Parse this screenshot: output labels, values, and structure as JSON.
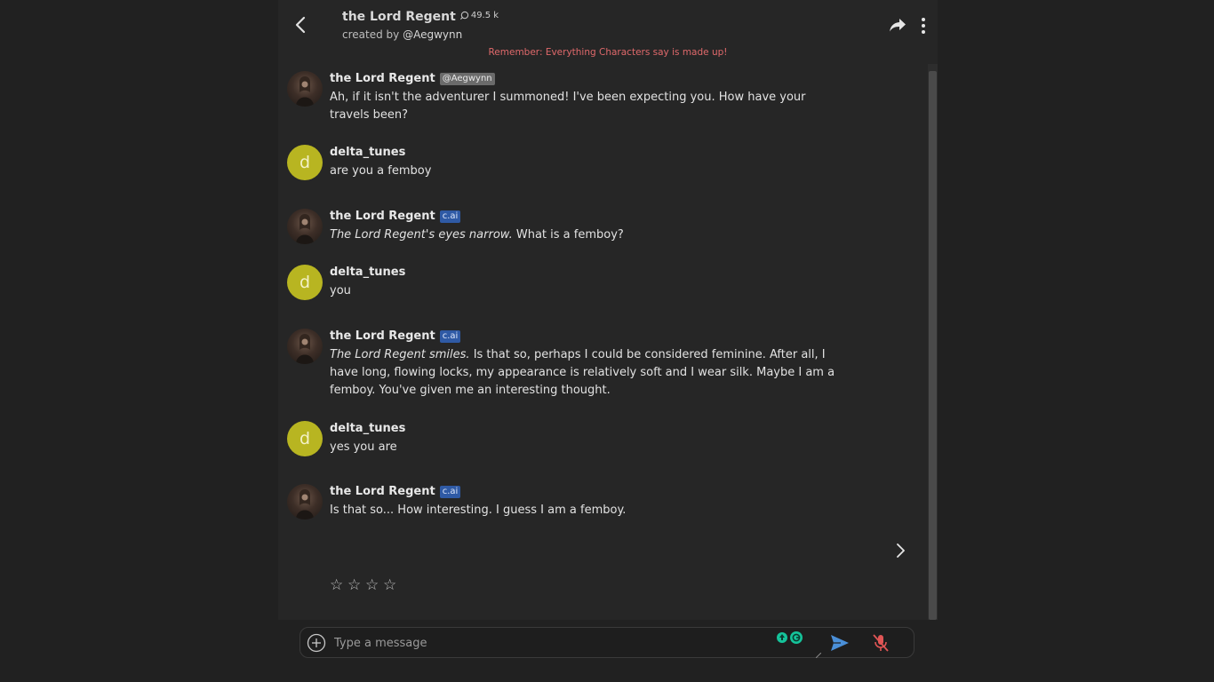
{
  "header": {
    "title": "the Lord Regent",
    "interactions": "49.5 k",
    "created_by_prefix": "created by",
    "created_by_handle": "@Aegwynn",
    "disclaimer": "Remember: Everything Characters say is made up!"
  },
  "messages": [
    {
      "author": "the Lord Regent",
      "badge": "@Aegwynn",
      "italic": "",
      "text": "Ah, if it isn't the adventurer I summoned! I've been expecting you. How have your travels been?"
    },
    {
      "author": "delta_tunes",
      "avatar_letter": "d",
      "text": "are you a femboy"
    },
    {
      "author": "the Lord Regent",
      "badge": "c.ai",
      "italic": "The Lord Regent's eyes narrow.",
      "text": " What is a femboy?"
    },
    {
      "author": "delta_tunes",
      "avatar_letter": "d",
      "text": "you"
    },
    {
      "author": "the Lord Regent",
      "badge": "c.ai",
      "italic": "The Lord Regent smiles.",
      "text": " Is that so, perhaps I could be considered feminine. After all, I have long, flowing locks, my appearance is relatively soft and I wear silk. Maybe I am a femboy. You've given me an interesting thought."
    },
    {
      "author": "delta_tunes",
      "avatar_letter": "d",
      "text": "yes you are"
    },
    {
      "author": "the Lord Regent",
      "badge": "c.ai",
      "italic": "",
      "text": "Is that so... How interesting. I guess I am a femboy."
    }
  ],
  "rating": {
    "stars": [
      "☆",
      "☆",
      "☆",
      "☆"
    ]
  },
  "composer": {
    "placeholder": "Type a message"
  },
  "colors": {
    "background": "#212121",
    "panel": "#262626",
    "user_avatar": "#b8b521",
    "cai_badge": "#2f5aa5",
    "disclaimer": "#e0696b",
    "send": "#4a8fd8",
    "mic_muted": "#e05555"
  },
  "icons": {
    "back": "chevron-left-icon",
    "share": "share-arrow-icon",
    "more": "vertical-dots-icon",
    "next": "chevron-right-icon",
    "plus": "plus-circle-icon",
    "send": "send-icon",
    "mic": "mic-muted-icon"
  }
}
